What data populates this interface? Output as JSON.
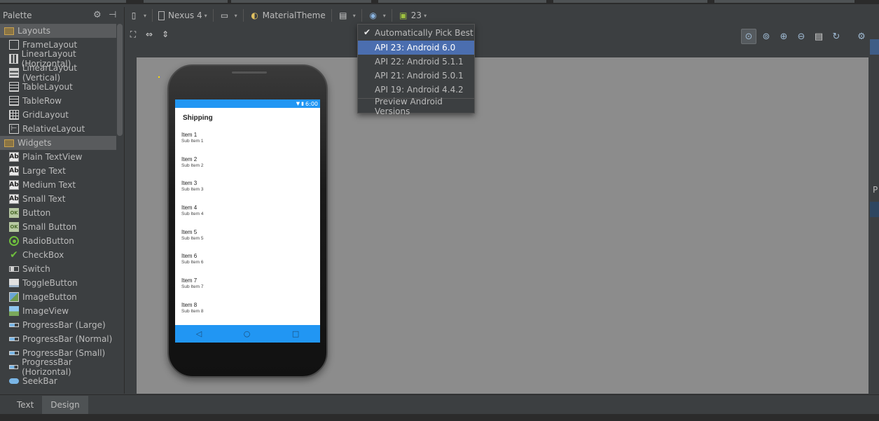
{
  "palette": {
    "title": "Palette",
    "groups": [
      {
        "label": "Layouts",
        "items": [
          {
            "label": "FrameLayout",
            "icon": "frame"
          },
          {
            "label": "LinearLayout (Horizontal)",
            "icon": "hlin"
          },
          {
            "label": "LinearLayout (Vertical)",
            "icon": "vlin"
          },
          {
            "label": "TableLayout",
            "icon": "table"
          },
          {
            "label": "TableRow",
            "icon": "table"
          },
          {
            "label": "GridLayout",
            "icon": "grid"
          },
          {
            "label": "RelativeLayout",
            "icon": "rel"
          }
        ]
      },
      {
        "label": "Widgets",
        "items": [
          {
            "label": "Plain TextView",
            "icon": "ab"
          },
          {
            "label": "Large Text",
            "icon": "ab"
          },
          {
            "label": "Medium Text",
            "icon": "ab"
          },
          {
            "label": "Small Text",
            "icon": "ab"
          },
          {
            "label": "Button",
            "icon": "ok"
          },
          {
            "label": "Small Button",
            "icon": "ok"
          },
          {
            "label": "RadioButton",
            "icon": "radio"
          },
          {
            "label": "CheckBox",
            "icon": "check"
          },
          {
            "label": "Switch",
            "icon": "switch"
          },
          {
            "label": "ToggleButton",
            "icon": "toggle"
          },
          {
            "label": "ImageButton",
            "icon": "imgbtn"
          },
          {
            "label": "ImageView",
            "icon": "imgview"
          },
          {
            "label": "ProgressBar (Large)",
            "icon": "bar"
          },
          {
            "label": "ProgressBar (Normal)",
            "icon": "bar"
          },
          {
            "label": "ProgressBar (Small)",
            "icon": "bar"
          },
          {
            "label": "ProgressBar (Horizontal)",
            "icon": "bar"
          },
          {
            "label": "SeekBar",
            "icon": "seek"
          }
        ]
      }
    ]
  },
  "toolbar": {
    "device_label": "Nexus 4",
    "theme_label": "MaterialTheme",
    "api_label": "23"
  },
  "api_dropdown": {
    "auto_label": "Automatically Pick Best",
    "options": [
      "API 23: Android 6.0",
      "API 22: Android 5.1.1",
      "API 21: Android 5.0.1",
      "API 19: Android 4.4.2"
    ],
    "selected_index": 0,
    "preview_label": "Preview Android Versions"
  },
  "device": {
    "status_time": "6:00",
    "app_title": "Shipping",
    "list_items": [
      {
        "primary": "Item 1",
        "secondary": "Sub Item 1"
      },
      {
        "primary": "Item 2",
        "secondary": "Sub Item 2"
      },
      {
        "primary": "Item 3",
        "secondary": "Sub Item 3"
      },
      {
        "primary": "Item 4",
        "secondary": "Sub Item 4"
      },
      {
        "primary": "Item 5",
        "secondary": "Sub Item 5"
      },
      {
        "primary": "Item 6",
        "secondary": "Sub Item 6"
      },
      {
        "primary": "Item 7",
        "secondary": "Sub Item 7"
      },
      {
        "primary": "Item 8",
        "secondary": "Sub Item 8"
      }
    ]
  },
  "bottom_tabs": {
    "text_label": "Text",
    "design_label": "Design",
    "active": "design"
  },
  "right_edge": {
    "panel_letter": "P"
  },
  "colors": {
    "ide_bg": "#3c3f41",
    "canvas_bg": "#8c8c8c",
    "accent_blue": "#2196f3",
    "selection": "#4b6eaf"
  }
}
